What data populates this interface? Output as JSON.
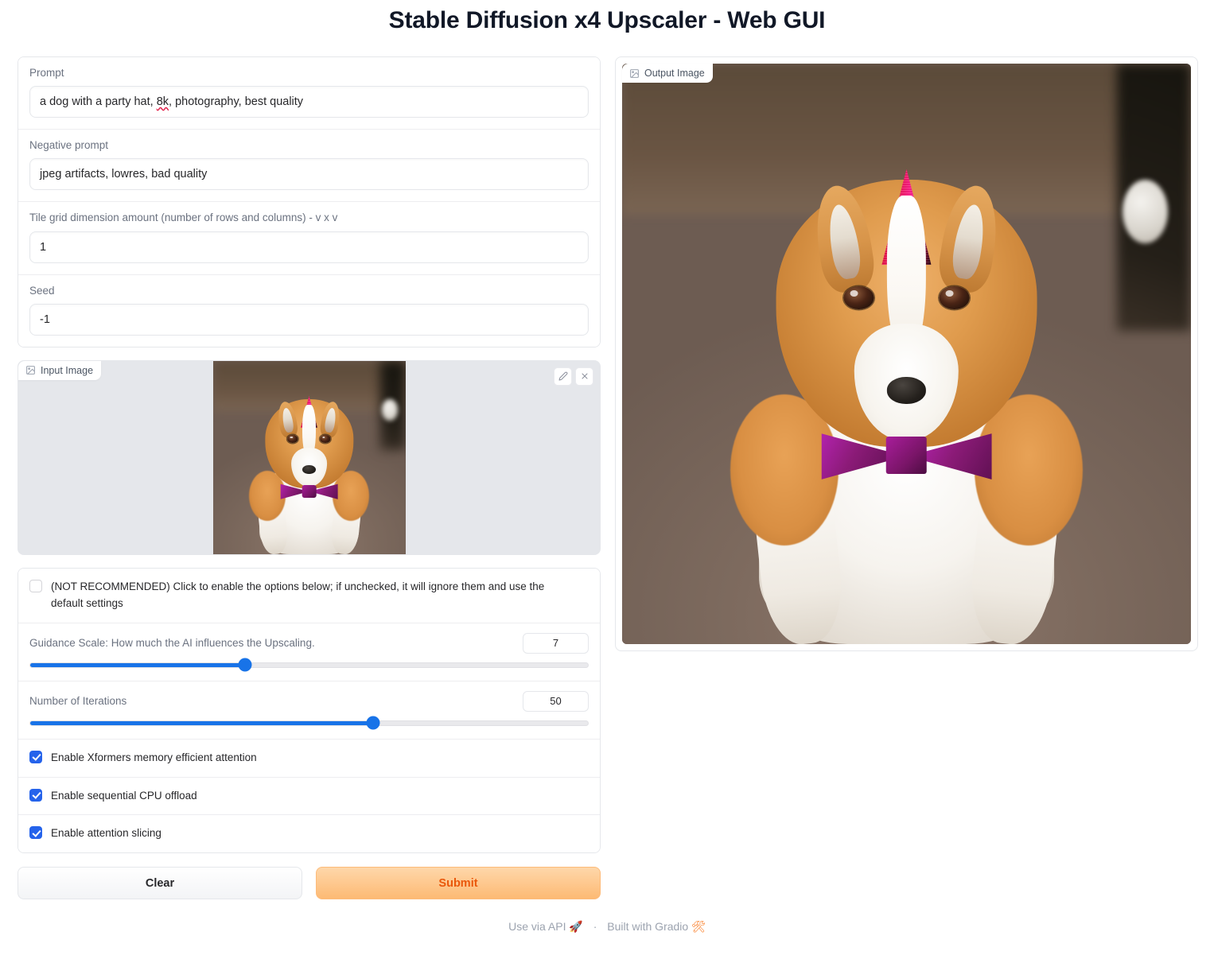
{
  "app": {
    "title": "Stable Diffusion x4 Upscaler - Web GUI"
  },
  "form": {
    "prompt": {
      "label": "Prompt",
      "value": "a dog with a party hat, 8k, photography, best quality",
      "value_pre": "a dog with a party hat, ",
      "value_misspelled": "8k",
      "value_post": ", photography, best quality",
      "placeholder": ""
    },
    "negative_prompt": {
      "label": "Negative prompt",
      "value": "jpeg artifacts, lowres, bad quality",
      "placeholder": ""
    },
    "tile_grid": {
      "label": "Tile grid dimension amount (number of rows and columns) - v x v",
      "value": "1",
      "placeholder": ""
    },
    "seed": {
      "label": "Seed",
      "value": "-1",
      "placeholder": ""
    }
  },
  "input_image": {
    "label": "Input Image",
    "icon": "image-icon",
    "edit_icon": "pencil-icon",
    "clear_icon": "close-icon"
  },
  "output_image": {
    "label": "Output Image",
    "icon": "image-icon"
  },
  "options": {
    "enable_advanced": {
      "label": "(NOT RECOMMENDED) Click to enable the options below; if unchecked, it will ignore them and use the default settings",
      "checked": false
    },
    "guidance_scale": {
      "label": "Guidance Scale: How much the AI influences the Upscaling.",
      "value": "7",
      "percent": 38.5
    },
    "iterations": {
      "label": "Number of Iterations",
      "value": "50",
      "percent": 61.5
    },
    "xformers": {
      "label": "Enable Xformers memory efficient attention",
      "checked": true
    },
    "cpu_offload": {
      "label": "Enable sequential CPU offload",
      "checked": true
    },
    "attention_slicing": {
      "label": "Enable attention slicing",
      "checked": true
    }
  },
  "actions": {
    "clear_label": "Clear",
    "submit_label": "Submit"
  },
  "footer": {
    "api_label": "Use via API",
    "api_icon": "rocket-icon",
    "separator": "·",
    "gradio_label": "Built with Gradio",
    "gradio_icon": "gradio-logo-icon"
  },
  "colors": {
    "accent_blue": "#1873e8",
    "submit_orange": "#ea580c",
    "submit_bg": "#fdba74",
    "panel_border": "#e5e7eb",
    "label_gray": "#6b7280"
  }
}
